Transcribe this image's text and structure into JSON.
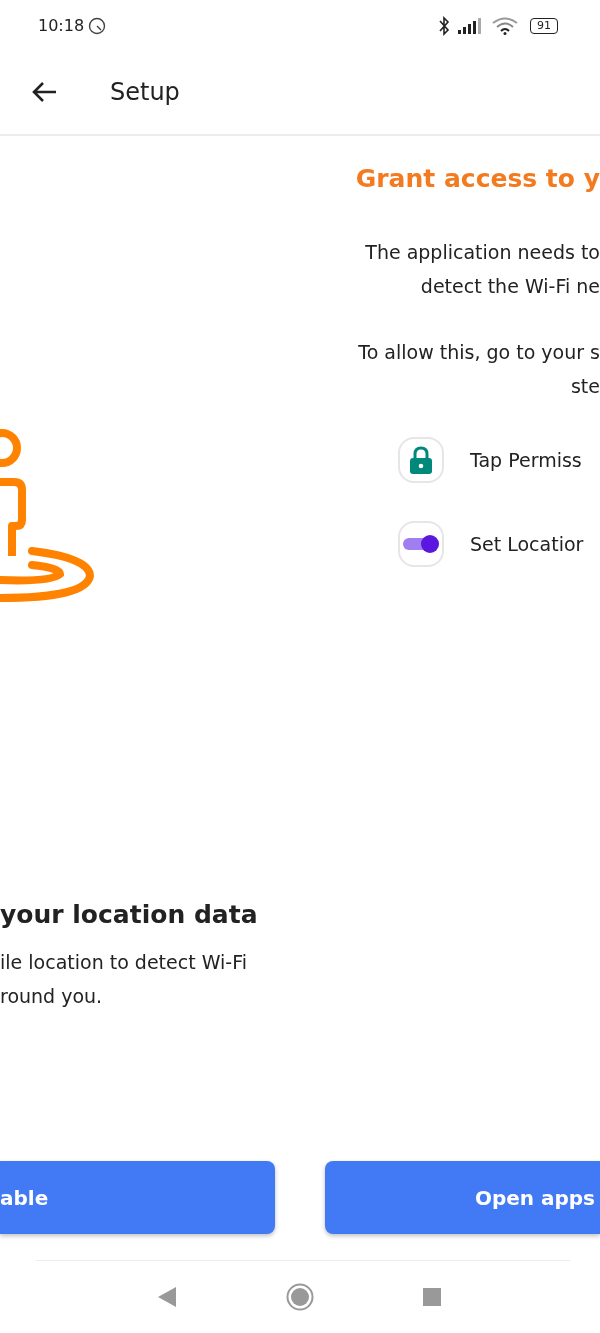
{
  "status_bar": {
    "time": "10:18",
    "battery": "91"
  },
  "app_bar": {
    "title": "Setup"
  },
  "previous_page": {
    "heading": "your location data",
    "body_lines": [
      "ile location to detect Wi-Fi",
      "round you."
    ],
    "button": "able"
  },
  "current_page": {
    "heading": "Grant access to y",
    "paragraphs": [
      [
        "The application needs to",
        "detect the Wi-Fi ne"
      ],
      [
        "To allow this, go to your s",
        "ste"
      ]
    ],
    "steps": [
      {
        "kind": "lock",
        "text": "Tap Permiss"
      },
      {
        "kind": "toggle",
        "text": "Set Locatior"
      }
    ],
    "button": "Open apps"
  }
}
